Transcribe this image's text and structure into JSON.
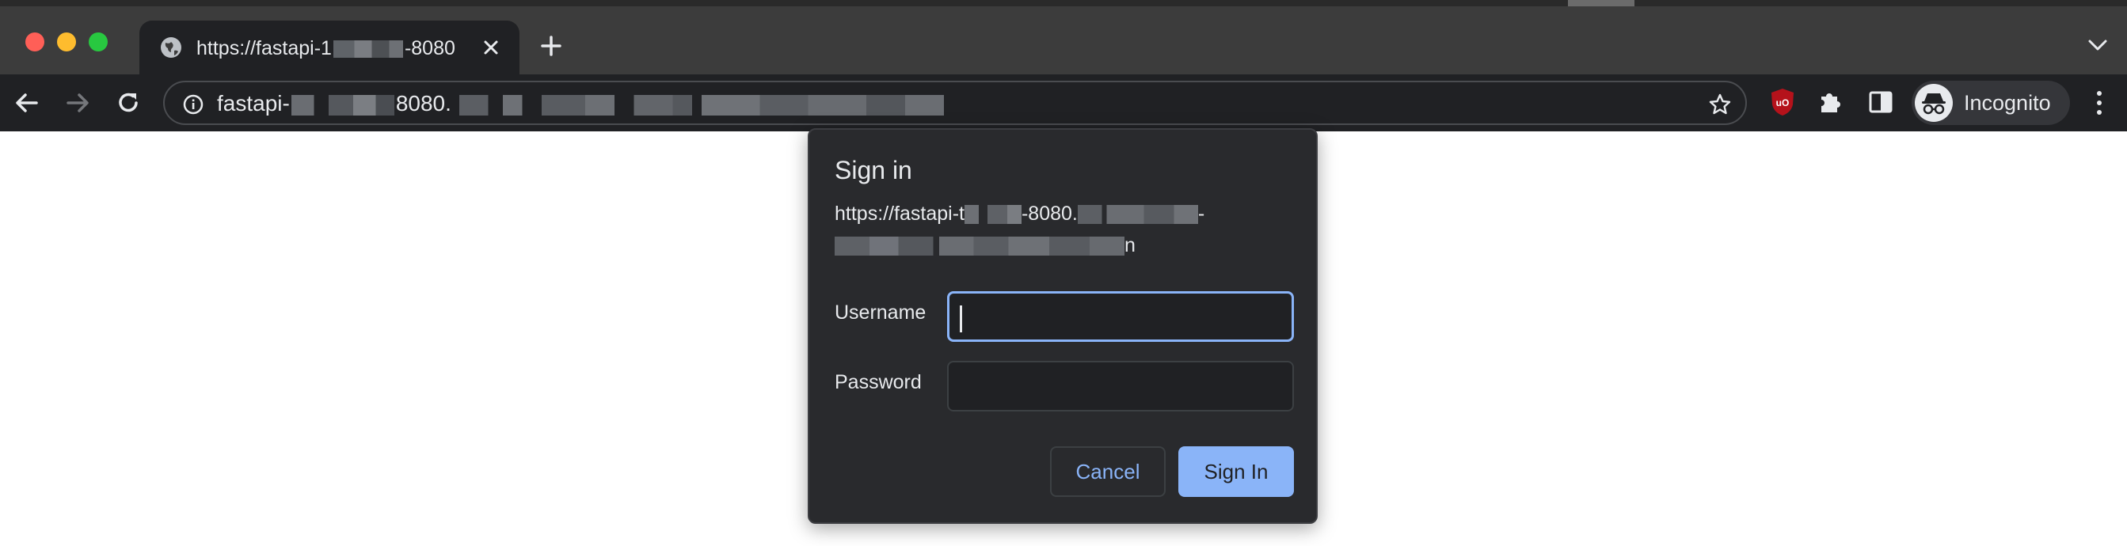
{
  "window": {
    "traffic_lights": [
      "close",
      "minimize",
      "zoom"
    ]
  },
  "tab": {
    "title": "https://fastapi-1",
    "title_tail": "-8080",
    "favicon": "globe-icon"
  },
  "toolbar": {
    "url_prefix": "fastapi-",
    "url_mid": "8080.",
    "profile_label": "Incognito"
  },
  "dialog": {
    "title": "Sign in",
    "url_line1_a": "https://fastapi-t",
    "url_line1_b": "-8080.",
    "url_line1_c": "-",
    "url_line2_end": "n",
    "username_label": "Username",
    "username_value": "",
    "password_label": "Password",
    "password_value": "",
    "cancel_label": "Cancel",
    "signin_label": "Sign In"
  },
  "colors": {
    "accent": "#8ab4f8",
    "dialog_bg": "#292a2d",
    "toolbar_bg": "#202124",
    "tabstrip_bg": "#3c3c3c",
    "ublock_red": "#b5121b"
  }
}
